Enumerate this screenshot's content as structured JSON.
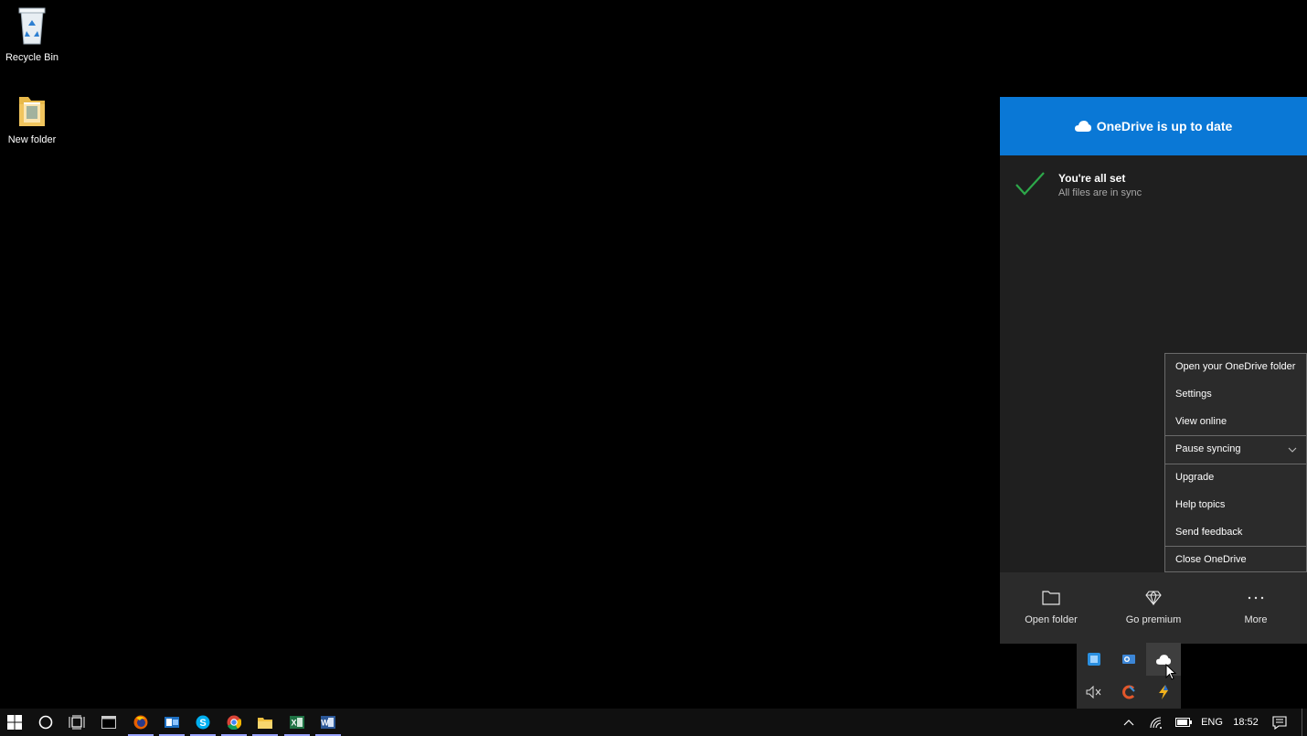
{
  "desktop": {
    "icons": [
      {
        "label": "Recycle Bin",
        "icon": "recycle-bin-icon"
      },
      {
        "label": "New folder",
        "icon": "folder-icon"
      }
    ]
  },
  "onedrive": {
    "header": "OneDrive is up to date",
    "status_title": "You're all set",
    "status_subtitle": "All files are in sync",
    "footer": {
      "open_folder": "Open folder",
      "go_premium": "Go premium",
      "more": "More"
    },
    "accent": "#0a78d6"
  },
  "context_menu": {
    "items": [
      {
        "label": "Open your OneDrive folder"
      },
      {
        "label": "Settings"
      },
      {
        "label": "View online"
      },
      {
        "label": "Pause syncing"
      },
      {
        "label": "Upgrade"
      },
      {
        "label": "Help topics"
      },
      {
        "label": "Send feedback"
      },
      {
        "label": "Close OneDrive"
      }
    ]
  },
  "tray_overflow": {
    "icons": [
      "app-tray-icon",
      "outlook-tray-icon",
      "onedrive-tray-icon",
      "volume-muted-icon",
      "ccleaner-icon",
      "winamp-icon"
    ]
  },
  "taskbar": {
    "apps": [
      "terminal-icon",
      "firefox-icon",
      "outlook-icon",
      "skype-icon",
      "chrome-icon",
      "file-explorer-icon",
      "excel-icon",
      "word-icon"
    ],
    "language": "ENG",
    "time": "18:52",
    "underline_color": "#99a4ff"
  }
}
